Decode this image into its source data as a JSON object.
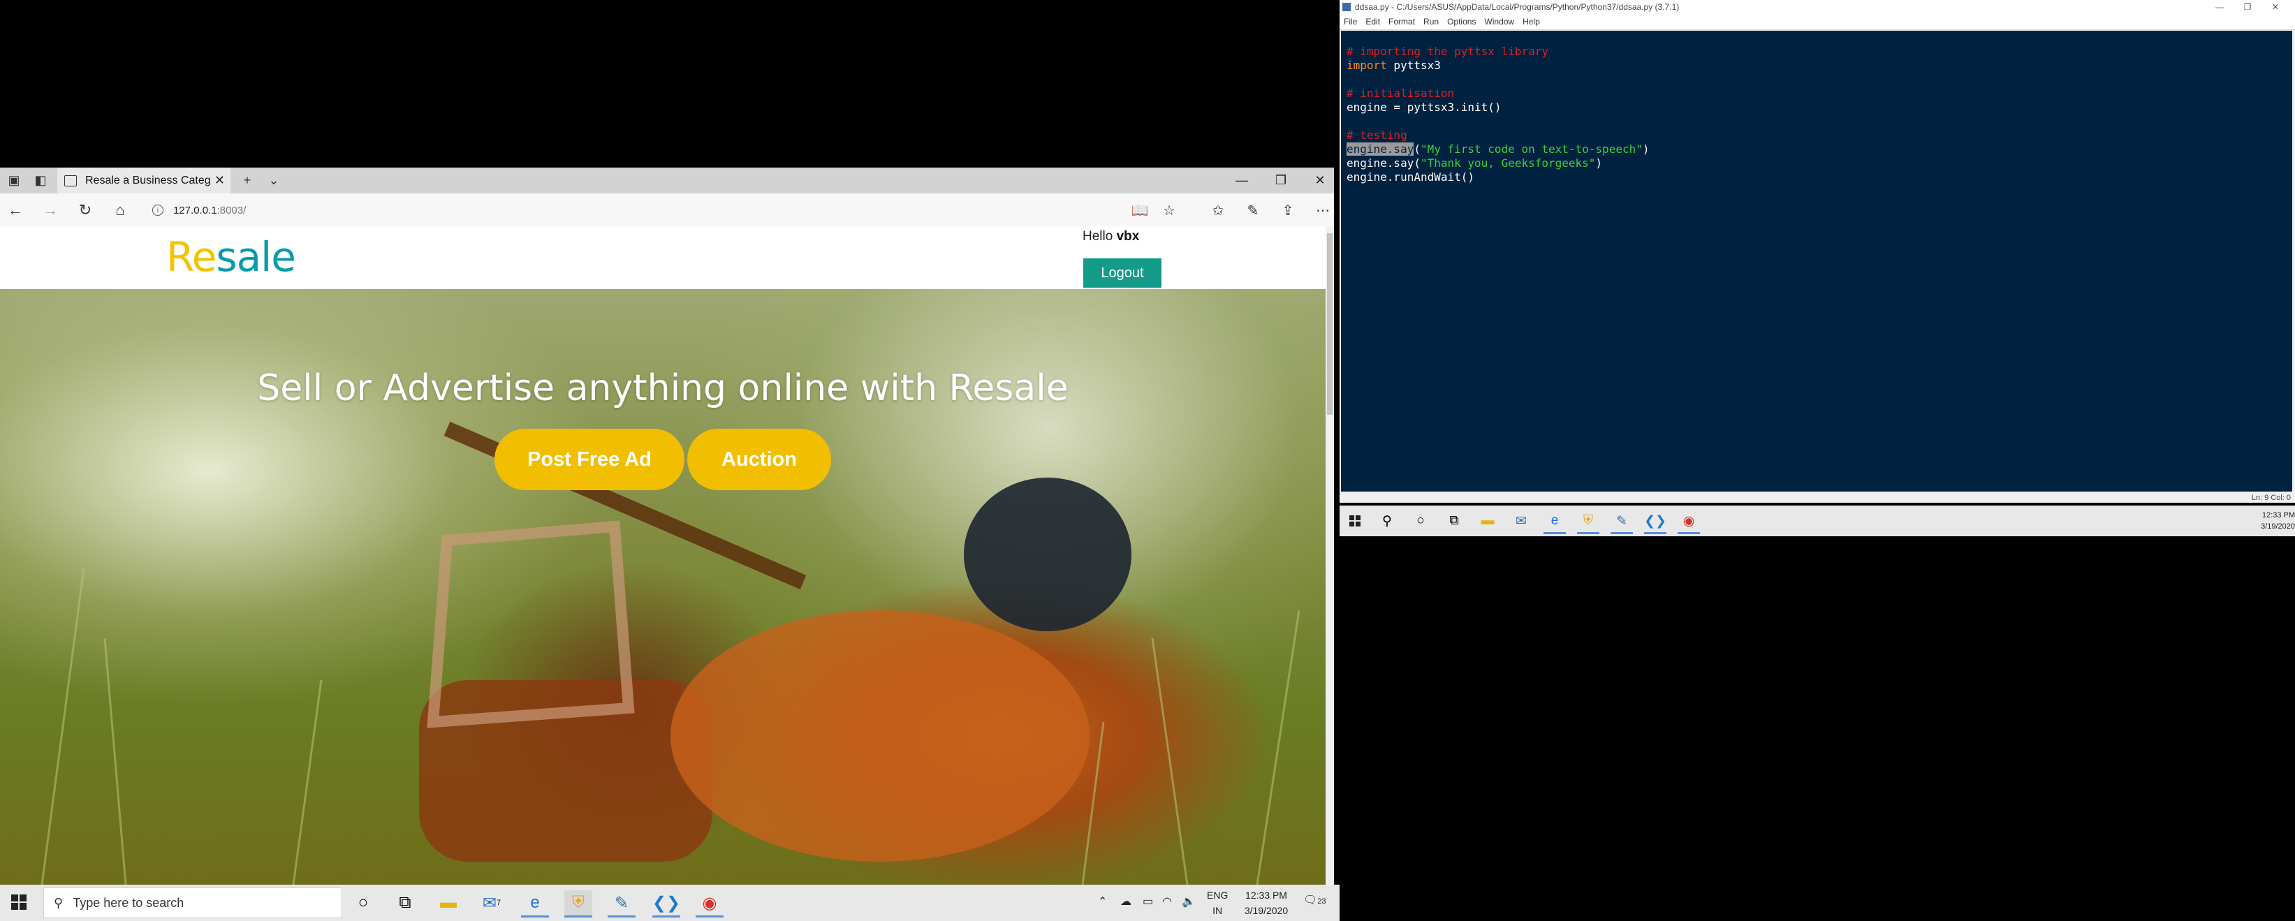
{
  "browser": {
    "tab_title": "Resale a Business Categ",
    "tab_close": "✕",
    "new_tab": "+",
    "tab_list": "⌄",
    "window_controls": {
      "minimize": "—",
      "restore": "❐",
      "close": "✕"
    },
    "nav": {
      "back": "←",
      "forward": "→",
      "refresh": "↻",
      "home": "⌂"
    },
    "url_host": "127.0.0.1",
    "url_port": ":8003/",
    "url_info": "i",
    "toolbar_icons": [
      "reading-view-icon",
      "favorite-star-icon",
      "favorites-list-icon",
      "pen-icon",
      "share-icon",
      "more-icon"
    ],
    "toolbar_glyphs": {
      "reading": "📖",
      "star": "☆",
      "favorites": "✩",
      "pen": "✎",
      "share": "⇪",
      "more": "⋯"
    }
  },
  "site": {
    "logo_re": "Re",
    "logo_sale": "sale",
    "hello_prefix": "Hello ",
    "username": "vbx",
    "logout_label": "Logout",
    "hero_title": "Sell or Advertise anything online with Resale",
    "post_ad_label": "Post Free Ad",
    "auction_label": "Auction",
    "accent_yellow": "#f1bf00",
    "accent_teal": "#159b8a"
  },
  "taskbar_left": {
    "search_placeholder": "Type here to search",
    "mail_badge": "7",
    "lang_line1": "ENG",
    "lang_line2": "IN",
    "time": "12:33 PM",
    "date": "3/19/2020",
    "notification_count": "23"
  },
  "idle": {
    "title": "ddsaa.py - C:/Users/ASUS/AppData/Local/Programs/Python/Python37/ddsaa.py (3.7.1)",
    "menu": [
      "File",
      "Edit",
      "Format",
      "Run",
      "Options",
      "Window",
      "Help"
    ],
    "code": {
      "c1": "# importing the pyttsx library",
      "l2_kw": "import",
      "l2_rest": " pyttsx3",
      "c4": "# initialisation",
      "l5": "engine = pyttsx3.init()",
      "c7": "# testing",
      "l8_sel": "engine.say",
      "l8_open": "(",
      "l8_str": "\"My first code on text-to-speech\"",
      "l8_close": ")",
      "l9_pre": "engine.say(",
      "l9_str": "\"Thank you, Geeksforgeeks\"",
      "l9_close": ")",
      "l10": "engine.runAndWait()"
    },
    "status": "Ln: 9   Col: 0"
  },
  "taskbar_right": {
    "time": "12:33 PM",
    "date": "3/19/2020"
  }
}
